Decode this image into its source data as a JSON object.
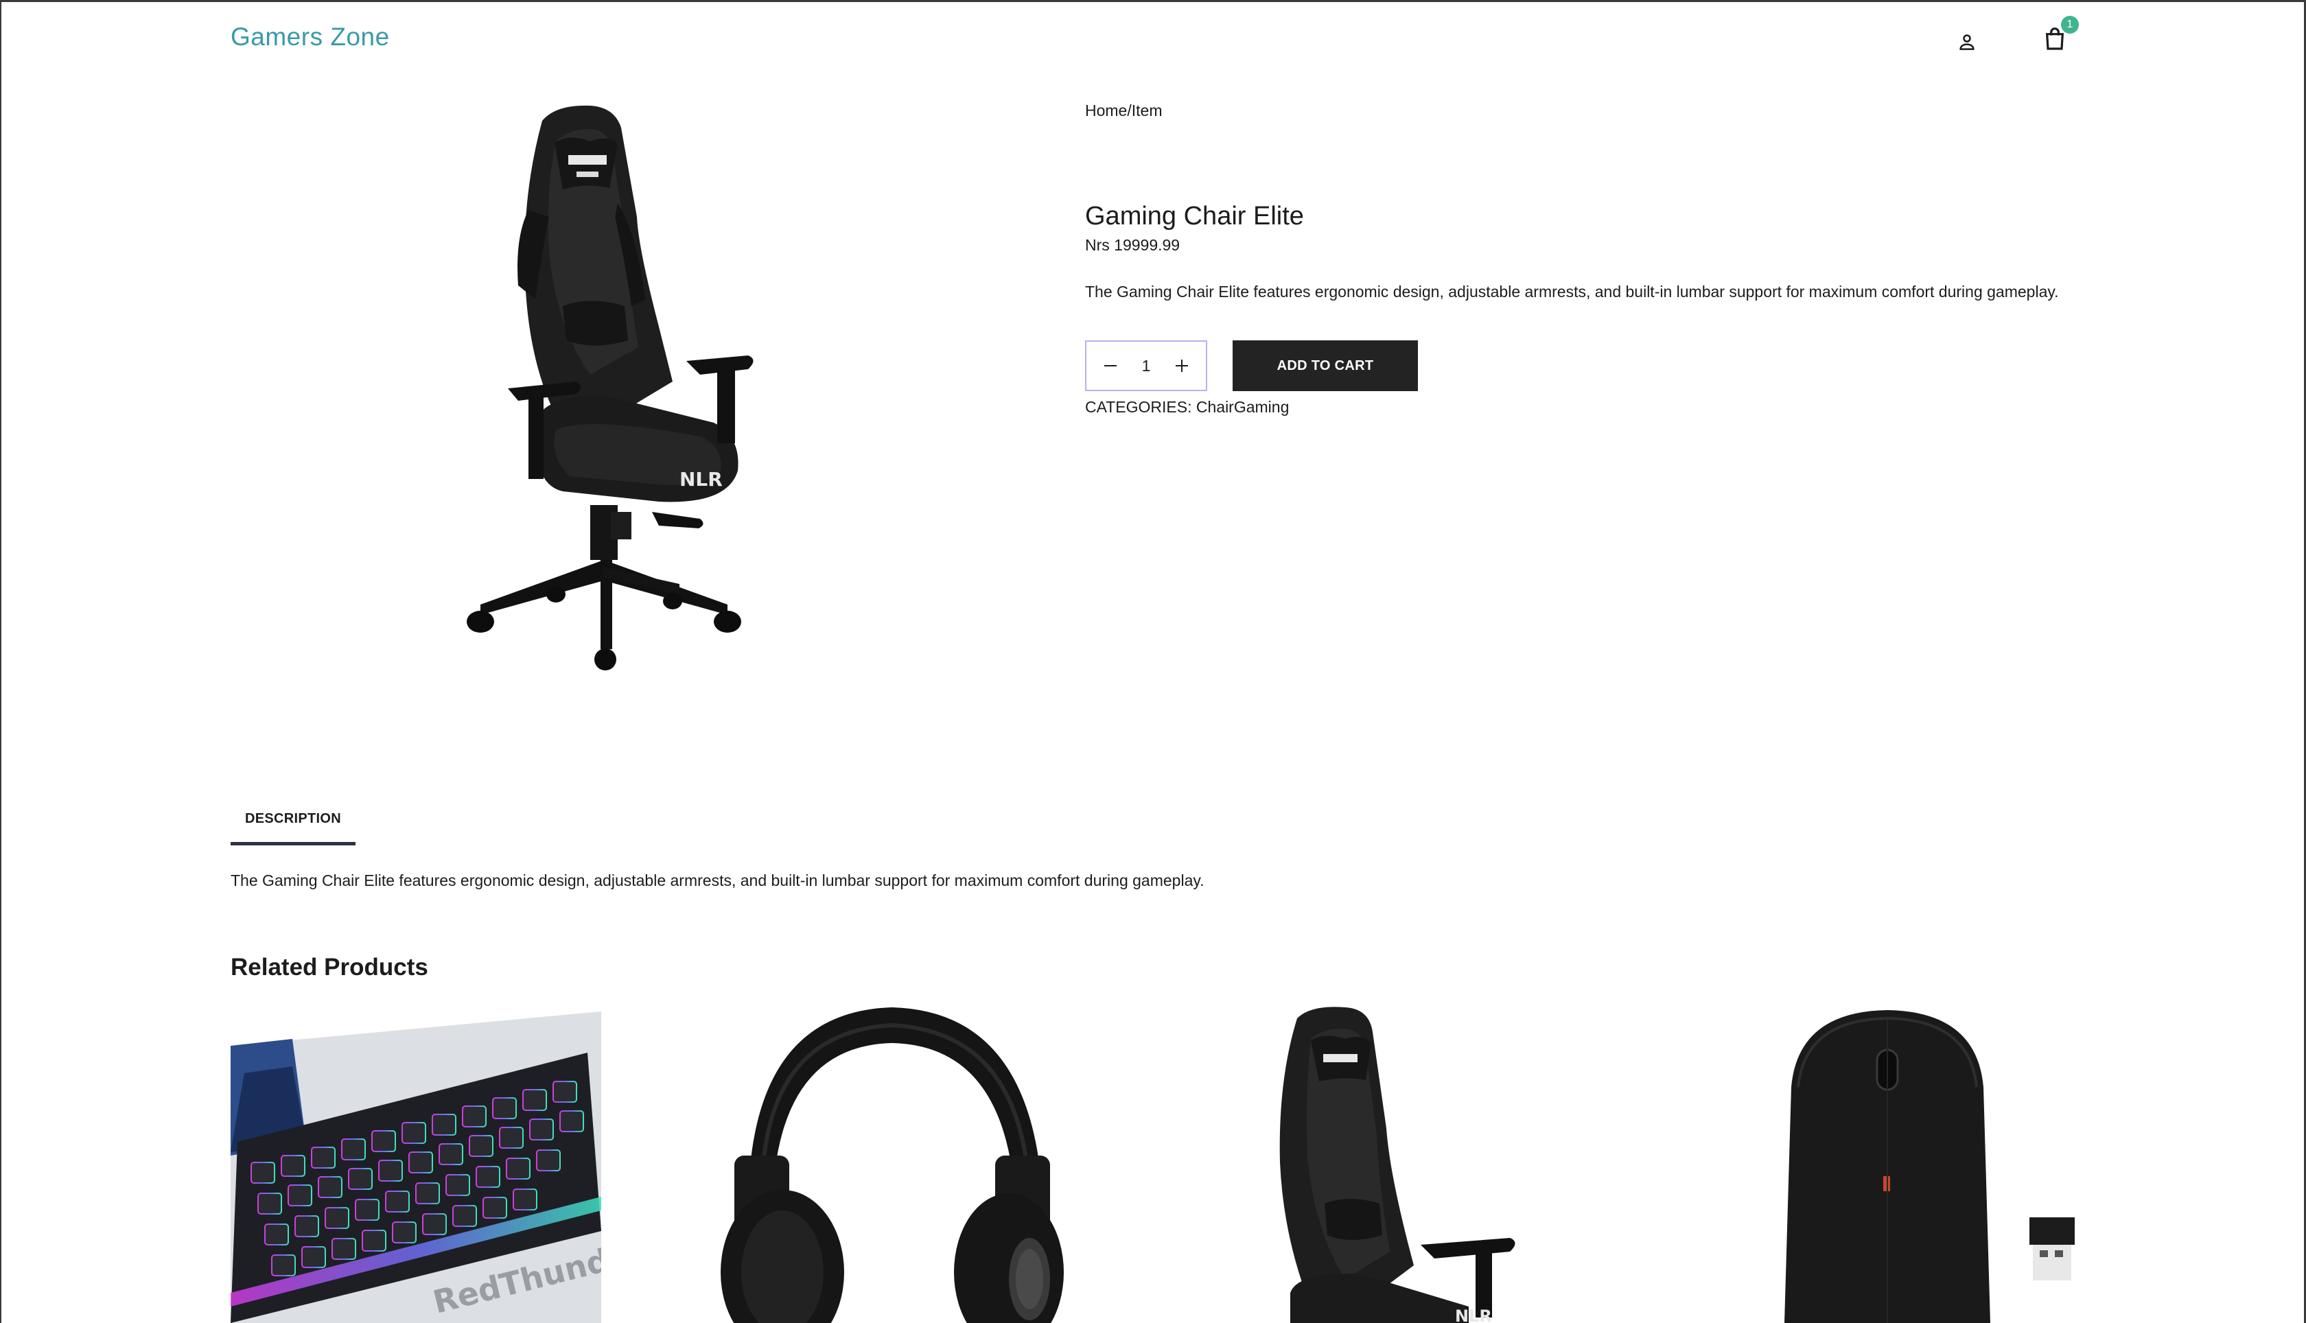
{
  "header": {
    "brand": "Gamers Zone",
    "cart_count": "1",
    "user_icon": "user-icon",
    "bag_icon": "shopping-bag-icon"
  },
  "product": {
    "breadcrumb": "Home/Item",
    "title": "Gaming Chair Elite",
    "price": "Nrs 19999.99",
    "description": "The Gaming Chair Elite features ergonomic design, adjustable armrests, and built-in lumbar support for maximum comfort during gameplay.",
    "quantity": "1",
    "add_to_cart_label": "ADD TO CART",
    "categories": "CATEGORIES: ChairGaming",
    "chair_logo": "NLR"
  },
  "tabs": {
    "description_label": "DESCRIPTION",
    "description_text": "The Gaming Chair Elite features ergonomic design, adjustable armrests, and built-in lumbar support for maximum comfort during gameplay."
  },
  "related": {
    "title": "Related Products",
    "items": [
      {
        "image": "rgb-keyboard",
        "brand_text": "RedThunder"
      },
      {
        "image": "black-headset"
      },
      {
        "image": "gaming-chair",
        "brand_text": "NLR"
      },
      {
        "image": "wireless-mouse"
      }
    ]
  },
  "colors": {
    "brand": "#3a9aa8",
    "badge": "#3fb58f",
    "button": "#232323",
    "qty_border": "#b8b2ee"
  }
}
